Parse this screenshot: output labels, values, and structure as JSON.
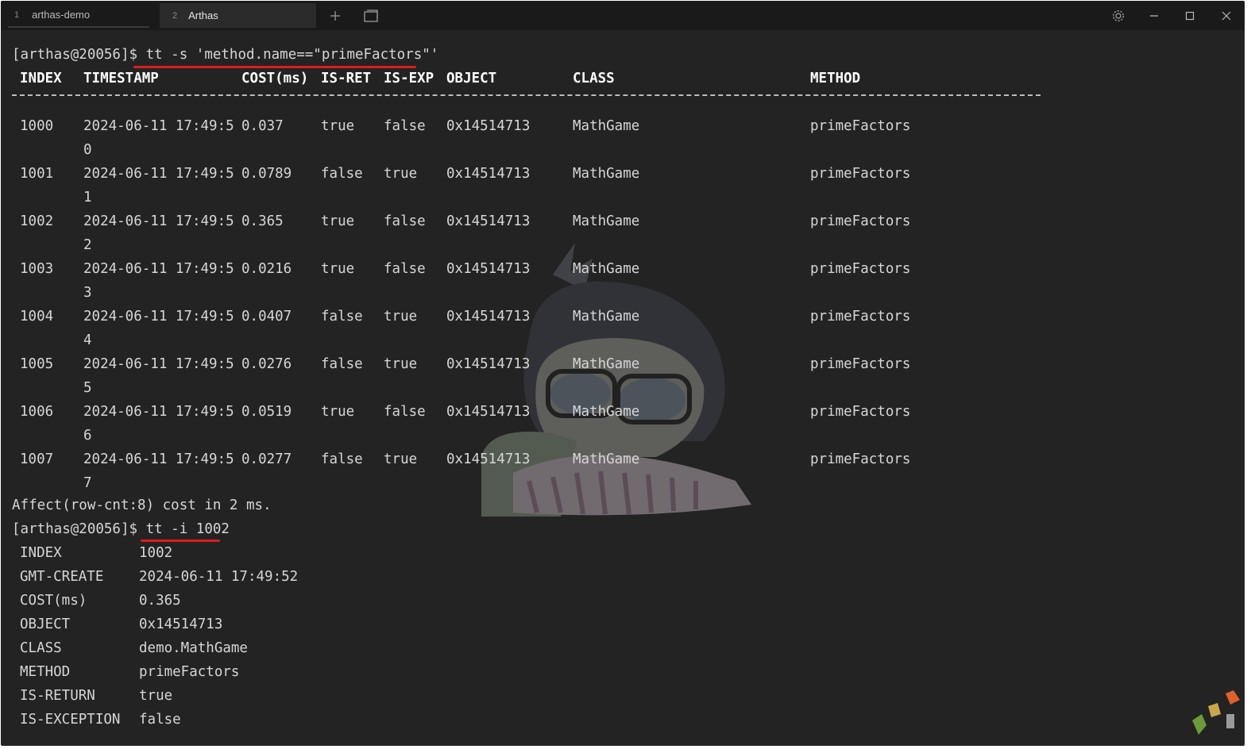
{
  "tabs": [
    {
      "num": "1",
      "label": "arthas-demo"
    },
    {
      "num": "2",
      "label": "Arthas"
    }
  ],
  "titlebar_icons": [
    "new-tab-icon",
    "tab-overview-icon",
    "gear-icon",
    "minimize-icon",
    "maximize-icon",
    "close-icon"
  ],
  "prompt": "[arthas@20056]$ ",
  "command1": "tt -s 'method.name==\"primeFactors\"'",
  "table": {
    "headers": [
      "INDEX",
      "TIMESTAMP",
      "COST(ms)",
      "IS-RET",
      "IS-EXP",
      "OBJECT",
      "CLASS",
      "METHOD"
    ],
    "separator": "-------------------------------------------------------------------------------------------------------------------------------------",
    "rows": [
      {
        "index": "1000",
        "ts": "2024-06-11 17:49:5",
        "ts2": "0",
        "cost": "0.037",
        "ret": "true",
        "exp": "false",
        "obj": "0x14514713",
        "cls": "MathGame",
        "method": "primeFactors"
      },
      {
        "index": "1001",
        "ts": "2024-06-11 17:49:5",
        "ts2": "1",
        "cost": "0.0789",
        "ret": "false",
        "exp": "true",
        "obj": "0x14514713",
        "cls": "MathGame",
        "method": "primeFactors"
      },
      {
        "index": "1002",
        "ts": "2024-06-11 17:49:5",
        "ts2": "2",
        "cost": "0.365",
        "ret": "true",
        "exp": "false",
        "obj": "0x14514713",
        "cls": "MathGame",
        "method": "primeFactors"
      },
      {
        "index": "1003",
        "ts": "2024-06-11 17:49:5",
        "ts2": "3",
        "cost": "0.0216",
        "ret": "true",
        "exp": "false",
        "obj": "0x14514713",
        "cls": "MathGame",
        "method": "primeFactors"
      },
      {
        "index": "1004",
        "ts": "2024-06-11 17:49:5",
        "ts2": "4",
        "cost": "0.0407",
        "ret": "false",
        "exp": "true",
        "obj": "0x14514713",
        "cls": "MathGame",
        "method": "primeFactors"
      },
      {
        "index": "1005",
        "ts": "2024-06-11 17:49:5",
        "ts2": "5",
        "cost": "0.0276",
        "ret": "false",
        "exp": "true",
        "obj": "0x14514713",
        "cls": "MathGame",
        "method": "primeFactors"
      },
      {
        "index": "1006",
        "ts": "2024-06-11 17:49:5",
        "ts2": "6",
        "cost": "0.0519",
        "ret": "true",
        "exp": "false",
        "obj": "0x14514713",
        "cls": "MathGame",
        "method": "primeFactors"
      },
      {
        "index": "1007",
        "ts": "2024-06-11 17:49:5",
        "ts2": "7",
        "cost": "0.0277",
        "ret": "false",
        "exp": "true",
        "obj": "0x14514713",
        "cls": "MathGame",
        "method": "primeFactors"
      }
    ]
  },
  "affect_line": "Affect(row-cnt:8) cost in 2 ms.",
  "command2": "tt -i 1002",
  "detail": [
    {
      "key": "INDEX",
      "value": "1002"
    },
    {
      "key": "GMT-CREATE",
      "value": "2024-06-11 17:49:52"
    },
    {
      "key": "COST(ms)",
      "value": "0.365"
    },
    {
      "key": "OBJECT",
      "value": "0x14514713"
    },
    {
      "key": "CLASS",
      "value": "demo.MathGame"
    },
    {
      "key": "METHOD",
      "value": "primeFactors"
    },
    {
      "key": "IS-RETURN",
      "value": "true"
    },
    {
      "key": "IS-EXCEPTION",
      "value": "false"
    }
  ],
  "colors": {
    "background": "#232323",
    "titlebar": "#1a1a1a",
    "text": "#d6d6d6",
    "header": "#ffffff",
    "underline": "#e01b1b"
  }
}
